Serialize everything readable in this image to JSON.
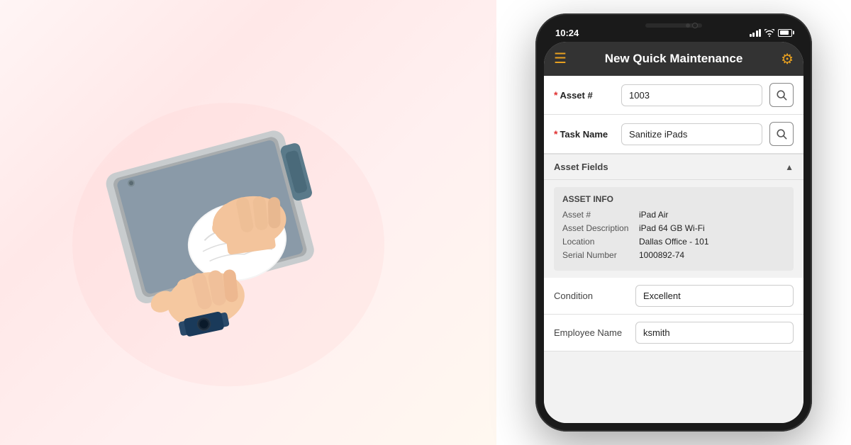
{
  "photo": {
    "alt": "Person cleaning a tablet with a cloth"
  },
  "phone": {
    "time": "10:24",
    "header": {
      "title": "New Quick Maintenance"
    },
    "form": {
      "asset_label": "Asset #",
      "asset_required": "*",
      "asset_value": "1003",
      "task_label": "Task Name",
      "task_required": "*",
      "task_value": "Sanitize iPads"
    },
    "asset_fields": {
      "header": "Asset Fields",
      "info_title": "ASSET INFO",
      "rows": [
        {
          "key": "Asset #",
          "value": "iPad Air"
        },
        {
          "key": "Asset Description",
          "value": "iPad 64 GB Wi-Fi"
        },
        {
          "key": "Location",
          "value": "Dallas Office - 101"
        },
        {
          "key": "Serial Number",
          "value": "1000892-74"
        }
      ]
    },
    "bottom_fields": [
      {
        "label": "Condition",
        "value": "Excellent"
      },
      {
        "label": "Employee Name",
        "value": "ksmith"
      }
    ]
  },
  "icons": {
    "hamburger": "☰",
    "gear": "⚙",
    "search": "🔍",
    "collapse": "▲"
  }
}
